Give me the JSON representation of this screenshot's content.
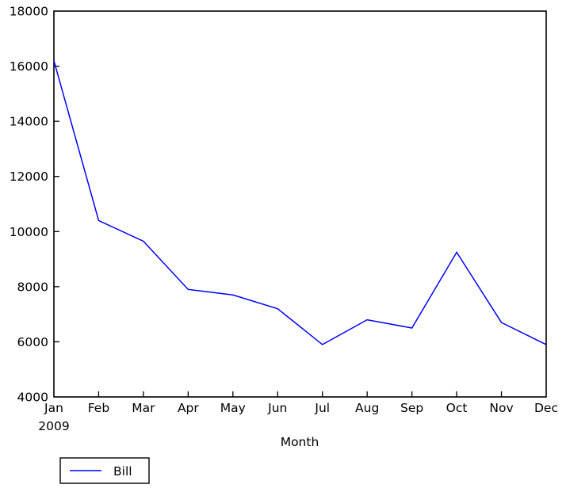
{
  "chart_data": {
    "type": "line",
    "title": "",
    "subtitle": "",
    "xlabel": "Month",
    "ylabel": "",
    "categories": [
      "Jan",
      "Feb",
      "Mar",
      "Apr",
      "May",
      "Jun",
      "Jul",
      "Aug",
      "Sep",
      "Oct",
      "Nov",
      "Dec"
    ],
    "x_sublabel": "2009",
    "series": [
      {
        "name": "Bill",
        "color": "#0000ff",
        "values": [
          16200,
          10400,
          9650,
          7900,
          7700,
          7200,
          5900,
          6800,
          6500,
          9250,
          6700,
          5900
        ]
      }
    ],
    "ylim": [
      4000,
      18000
    ],
    "yticks": [
      4000,
      6000,
      8000,
      10000,
      12000,
      14000,
      16000,
      18000
    ],
    "ytick_labels": [
      "4000",
      "6000",
      "8000",
      "10000",
      "12000",
      "14000",
      "16000",
      "18000"
    ],
    "xlim": [
      0,
      11
    ],
    "grid": false,
    "legend_position": "lower left",
    "legend_entries": [
      {
        "label": "Bill",
        "color": "#0000ff"
      }
    ]
  },
  "axes": {
    "x_axis_title": "Month",
    "y_axis_title": ""
  },
  "legend": {
    "items": [
      {
        "label": "Bill"
      }
    ]
  }
}
